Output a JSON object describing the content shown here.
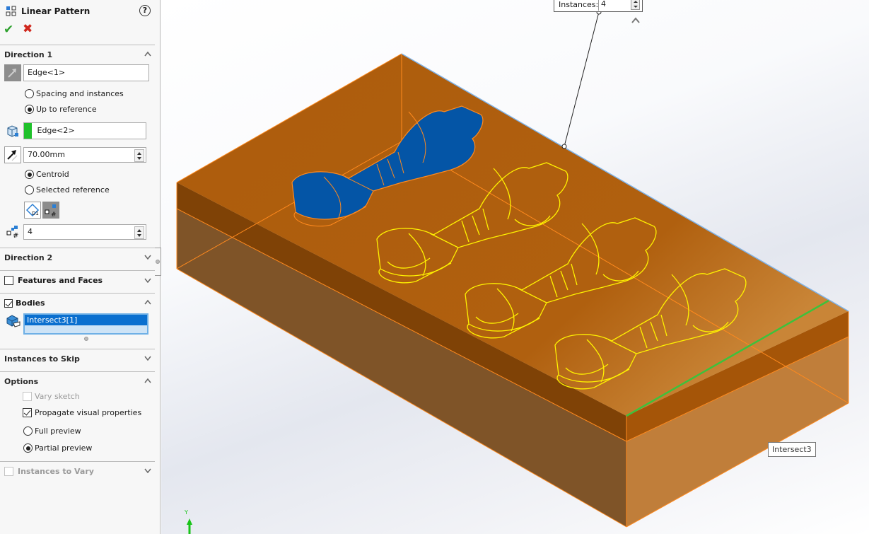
{
  "panel": {
    "title": "Linear Pattern",
    "help_icon": "help-icon",
    "ok_icon": "checkmark-icon",
    "cancel_icon": "close-icon",
    "direction1": {
      "label": "Direction 1",
      "edge_ref": "Edge<1>",
      "spacing_option": "Spacing and instances",
      "upto_option": "Up to reference",
      "selected_mode": "Up to reference",
      "reference_edge": "Edge<2>",
      "reference_color": "#1fc12a",
      "offset": "70.00mm",
      "centroid_option": "Centroid",
      "selected_ref_option": "Selected reference",
      "selected_ref_mode": "Centroid",
      "instances": "4"
    },
    "direction2": {
      "label": "Direction 2"
    },
    "features_faces": {
      "label": "Features and Faces",
      "checked": false
    },
    "bodies": {
      "label": "Bodies",
      "checked": true,
      "items": [
        "Intersect3[1]"
      ]
    },
    "instances_to_skip": {
      "label": "Instances to Skip"
    },
    "options": {
      "label": "Options",
      "vary_sketch": "Vary sketch",
      "propagate": "Propagate visual properties",
      "full_preview": "Full preview",
      "partial_preview": "Partial preview",
      "selected_preview": "Partial preview"
    },
    "instances_to_vary": {
      "label": "Instances to Vary",
      "checked": false
    }
  },
  "viewport": {
    "callout_label": "Instances:",
    "callout_value": "4",
    "tooltip": "Intersect3",
    "axis_label": "Y",
    "colors": {
      "body": "#b05f0e",
      "seed_body": "#0455a6",
      "preview_outline": "#fff200",
      "selected_edge": "#3cc23c"
    }
  }
}
